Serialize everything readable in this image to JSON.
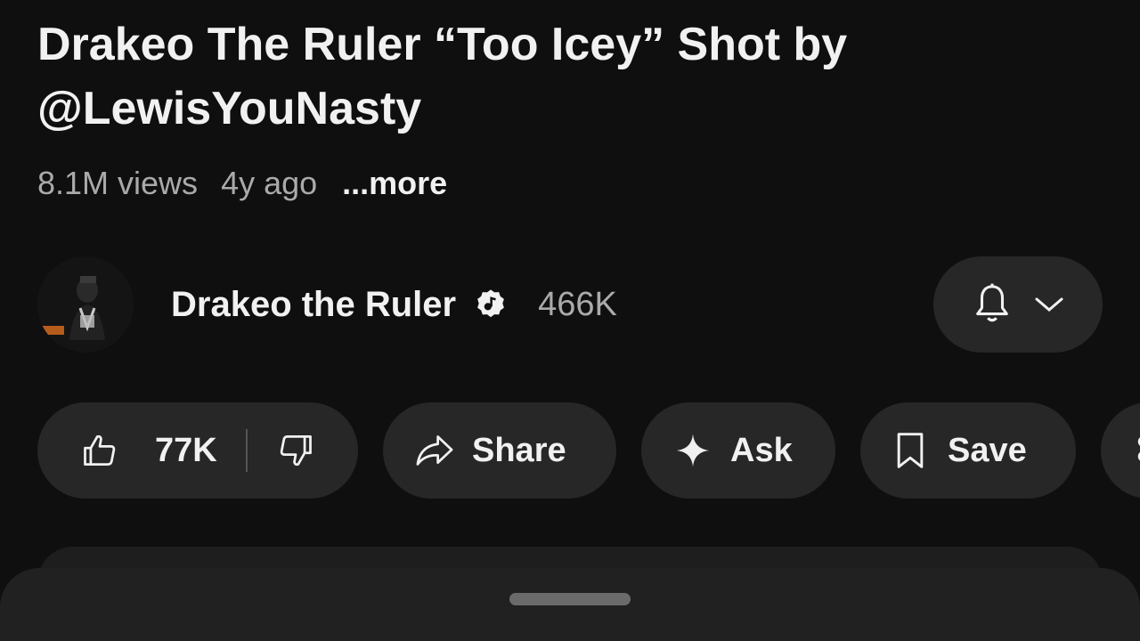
{
  "video": {
    "title": "Drakeo The Ruler “Too Icey” Shot by @LewisYouNasty",
    "views": "8.1M views",
    "age": "4y ago",
    "more_label": "...more"
  },
  "channel": {
    "name": "Drakeo the Ruler",
    "subscribers": "466K",
    "avatar_icon": "channel-avatar",
    "verified_icon": "verified-badge-icon"
  },
  "subscribe_menu": {
    "bell_icon": "bell-icon",
    "chevron_icon": "chevron-down-icon"
  },
  "actions": {
    "like_count": "77K",
    "share_label": "Share",
    "ask_label": "Ask",
    "save_label": "Save"
  },
  "colors": {
    "background": "#0f0f0f",
    "pill": "#272727",
    "text_primary": "#f1f1f1",
    "text_secondary": "#aaaaaa",
    "sheet": "#212121"
  }
}
